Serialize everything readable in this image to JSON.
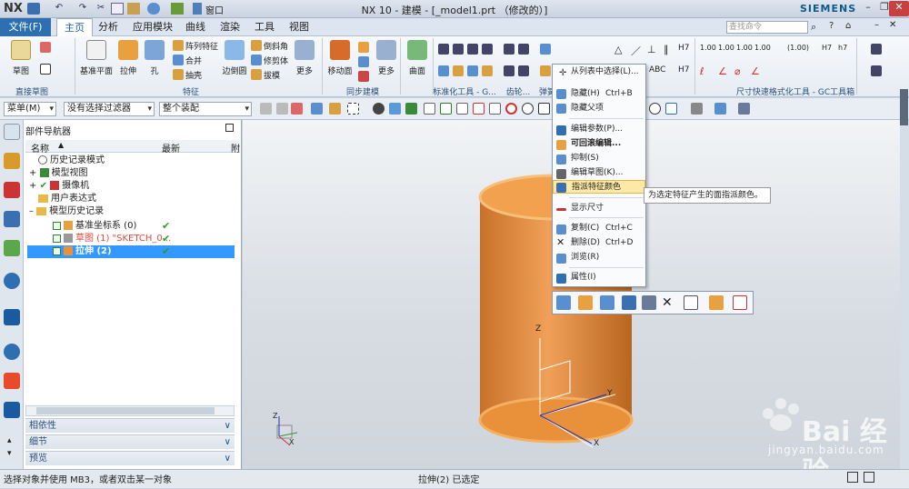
{
  "app": {
    "logo": "NX",
    "title": "NX 10 - 建模 - [_model1.prt  （修改的）]",
    "brand": "SIEMENS",
    "window_menu": "窗口"
  },
  "colors": {
    "accent": "#2e6fb1",
    "selection": "#3399ff",
    "cylinder": "#e8903a",
    "highlight": "#ffe9a8"
  },
  "menu": {
    "file": "文件(F)",
    "tabs": [
      "主页",
      "分析",
      "应用模块",
      "曲线",
      "渲染",
      "工具",
      "视图"
    ],
    "search_placeholder": "查找命令"
  },
  "ribbon": {
    "sketch_group": {
      "label": "直接草图",
      "sketch": "草图"
    },
    "feature_group": {
      "label": "特征",
      "datum_plane": "基准平面",
      "extrude": "拉伸",
      "hole": "孔",
      "pattern": "阵列特征",
      "unite": "合并",
      "shell": "抽壳",
      "edge_blend": "边倒圆",
      "chamfer": "倒斜角",
      "trim_body": "修剪体",
      "draft": "拔模",
      "more": "更多"
    },
    "sync_group": {
      "label": "同步建模",
      "move_face": "移动面",
      "more": "更多"
    },
    "surface": {
      "label": "曲面"
    },
    "std_tools": "标准化工具 - G...",
    "gear": "齿轮...",
    "spring": "弹簧",
    "dim_group": {
      "label": "尺寸快速格式化工具 - GC工具箱",
      "values": [
        "1.00",
        "1.00",
        "1.00",
        "1.00",
        "(1.00)",
        "H7",
        "h7"
      ]
    }
  },
  "toolbar2": {
    "menu": "菜单(M)",
    "filter": "没有选择过滤器",
    "scope": "整个装配"
  },
  "navigator": {
    "title": "部件导航器",
    "col_name": "名称",
    "col_latest": "最新",
    "col_c": "附",
    "items": [
      {
        "label": "历史记录模式"
      },
      {
        "label": "模型视图"
      },
      {
        "label": "摄像机"
      },
      {
        "label": "用户表达式"
      },
      {
        "label": "模型历史记录"
      },
      {
        "label": "基准坐标系 (0)"
      },
      {
        "label": "草图 (1) \"SKETCH_0..."
      },
      {
        "label": "拉伸 (2)"
      }
    ],
    "panels": [
      "相依性",
      "细节",
      "预览"
    ]
  },
  "context_menu": {
    "items": [
      {
        "label": "从列表中选择(L)..."
      },
      {
        "label": "隐藏(H)",
        "key": "Ctrl+B"
      },
      {
        "label": "隐藏父项"
      },
      {
        "label": "编辑参数(P)..."
      },
      {
        "label": "可回滚编辑..."
      },
      {
        "label": "抑制(S)"
      },
      {
        "label": "编辑草图(K)..."
      },
      {
        "label": "指派特征颜色"
      },
      {
        "label": "显示尺寸"
      },
      {
        "label": "复制(C)",
        "key": "Ctrl+C"
      },
      {
        "label": "删除(D)",
        "key": "Ctrl+D"
      },
      {
        "label": "浏览(R)"
      },
      {
        "label": "属性(I)"
      }
    ],
    "tooltip": "为选定特征产生的面指派颜色。"
  },
  "viewport": {
    "axis_z": "Z",
    "axis_y": "Y",
    "axis_x": "X",
    "watermark": "Bai 经验",
    "watermark_url": "jingyan.baidu.com"
  },
  "status": {
    "left": "选择对象并使用 MB3，或者双击某一对象",
    "center": "拉伸(2) 已选定"
  }
}
